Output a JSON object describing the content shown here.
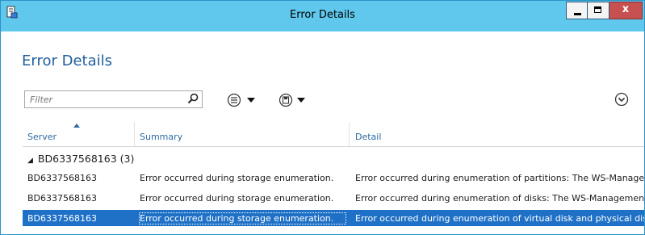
{
  "window": {
    "title": "Error Details",
    "close_label": "x"
  },
  "page": {
    "title": "Error Details"
  },
  "filter": {
    "placeholder": "Filter"
  },
  "columns": {
    "server": "Server",
    "summary": "Summary",
    "detail": "Detail"
  },
  "group": {
    "label": "BD6337568163 (3)"
  },
  "rows": [
    {
      "server": "BD6337568163",
      "summary": "Error occurred during storage enumeration.",
      "detail": "Error occurred during enumeration of partitions: The WS-Managen"
    },
    {
      "server": "BD6337568163",
      "summary": "Error occurred during storage enumeration.",
      "detail": "Error occurred during enumeration of disks: The WS-Management"
    },
    {
      "server": "BD6337568163",
      "summary": "Error occurred during storage enumeration.",
      "detail": "Error occurred during enumeration of virtual disk and physical disk"
    }
  ],
  "icons": {
    "app": "app-icon",
    "search": "search-icon",
    "list": "list-icon",
    "save": "save-icon",
    "expand": "chevron-down-circle-icon",
    "sort": "sort-ascending-icon"
  },
  "colors": {
    "titlebar": "#5fc8ec",
    "accent_text": "#1f5f9d",
    "selection": "#1f71c7",
    "close_button": "#c75050"
  }
}
